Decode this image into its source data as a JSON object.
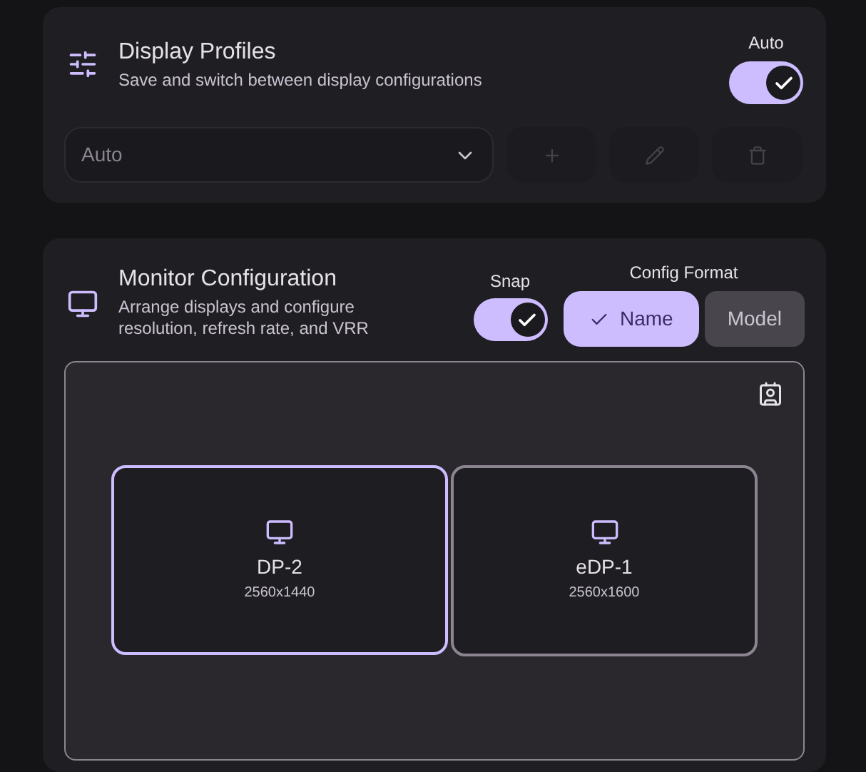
{
  "profiles": {
    "title": "Display Profiles",
    "subtitle": "Save and switch between display configurations",
    "auto_label": "Auto",
    "auto_on": true,
    "select": {
      "value": "Auto"
    },
    "buttons": [
      {
        "kind": "add",
        "disabled": true
      },
      {
        "kind": "edit",
        "disabled": true
      },
      {
        "kind": "delete",
        "disabled": true
      }
    ]
  },
  "monitor": {
    "title": "Monitor Configuration",
    "subtitle": "Arrange displays and configure resolution, refresh rate, and VRR",
    "snap_label": "Snap",
    "snap_on": true,
    "format_label": "Config Format",
    "formats": [
      {
        "label": "Name",
        "selected": true
      },
      {
        "label": "Model",
        "selected": false
      }
    ],
    "displays": [
      {
        "name": "DP-2",
        "resolution": "2560x1440",
        "selected": true
      },
      {
        "name": "eDP-1",
        "resolution": "2560x1600",
        "selected": false
      }
    ]
  }
}
